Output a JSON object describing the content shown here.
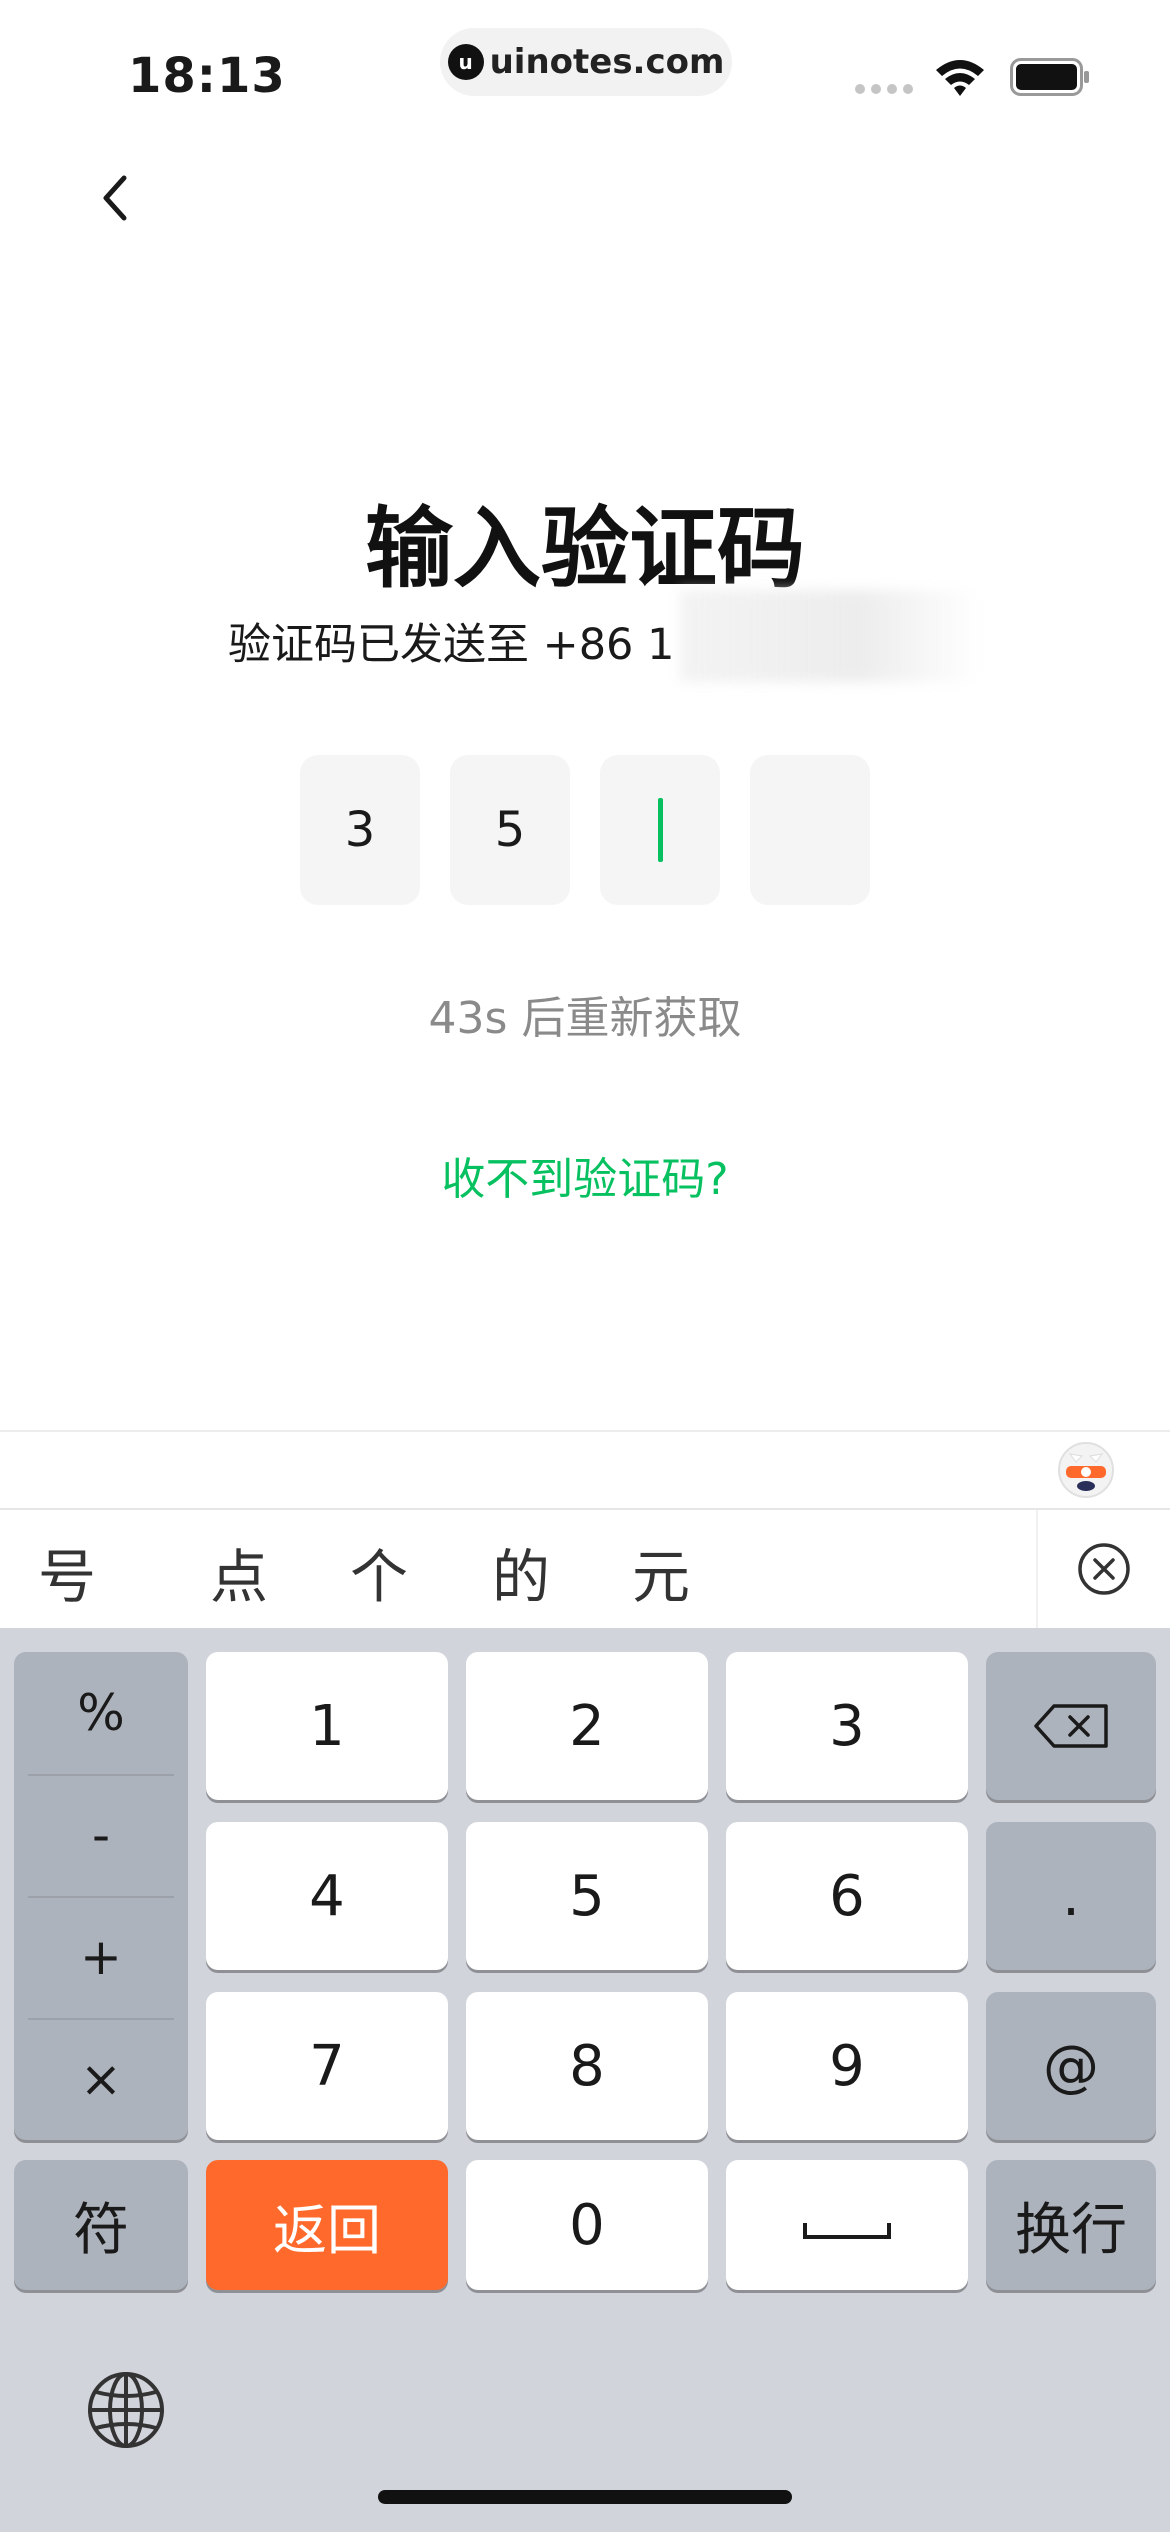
{
  "status_bar": {
    "time": "18:13",
    "url": "uinotes.com",
    "logo_letter": "u"
  },
  "page": {
    "title": "输入验证码",
    "subtitle": "验证码已发送至 +86 1",
    "code_digits": [
      "3",
      "5",
      "",
      ""
    ],
    "resend_text": "43s 后重新获取",
    "no_code_link": "收不到验证码?"
  },
  "colors": {
    "accent": "#07c160",
    "return_key": "#ff6a2c",
    "keyboard_bg": "#d1d4db"
  },
  "keyboard": {
    "candidates": [
      "号",
      "点",
      "个",
      "的",
      "元"
    ],
    "symbols": [
      "%",
      "-",
      "+",
      "×"
    ],
    "digits": [
      "1",
      "2",
      "3",
      "4",
      "5",
      "6",
      "7",
      "8",
      "9",
      "0"
    ],
    "right_keys": [
      ".",
      "@"
    ],
    "fu_label": "符",
    "return_label": "返回",
    "newline_label": "换行",
    "icons": [
      "back-chevron-icon",
      "wifi-icon",
      "battery-icon",
      "mascot-icon",
      "close-circle-icon",
      "backspace-icon",
      "space-icon",
      "globe-icon"
    ]
  }
}
